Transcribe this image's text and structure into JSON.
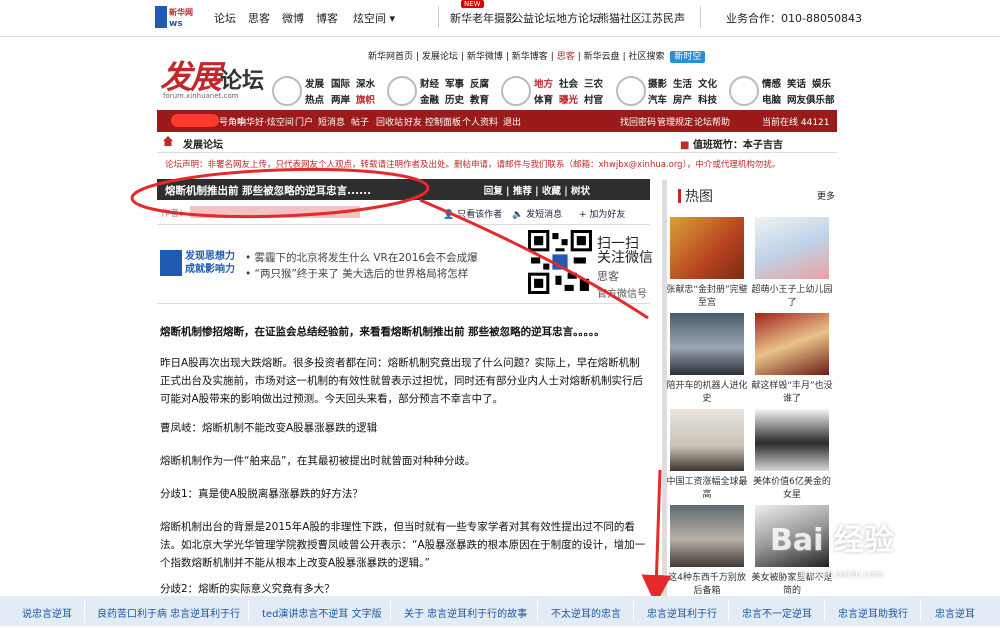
{
  "topnav": {
    "links": [
      "论坛",
      "思客",
      "微博",
      "博客",
      "炫空间"
    ],
    "links2": [
      "新华老年摄影",
      "公益论坛",
      "地方论坛",
      "熊猫社区",
      "江苏民声"
    ],
    "new_badge": "NEW",
    "contact": "业务合作：010-88050843",
    "logo_text": "新华网"
  },
  "site_links": [
    "新华网首页",
    "发展论坛",
    "新华微博",
    "新华博客",
    "思客",
    "新华云盘",
    "社区搜索"
  ],
  "site_links_badge": "新时空",
  "forum": {
    "title_red": "发展",
    "title_black": "论坛",
    "subtitle": "forum.xinhuanet.com"
  },
  "channels": {
    "g1": [
      "发展",
      "国际",
      "深水",
      "热点",
      "两岸",
      "旗帜"
    ],
    "g2": [
      "财经",
      "军事",
      "反腐",
      "金融",
      "历史",
      "教育"
    ],
    "g3": [
      "地方",
      "社会",
      "三农",
      "体育",
      "曝光",
      "村官"
    ],
    "g4": [
      "摄影",
      "生活",
      "文化",
      "汽车",
      "房产",
      "科技"
    ],
    "g5": [
      "情感",
      "笑话",
      "娱乐",
      "电脑",
      "网友俱乐部"
    ]
  },
  "redbar": {
    "items": [
      "号角响",
      "中华好·炫空间",
      "门户",
      "短消息",
      "帖子",
      "回收站",
      "好友",
      "控制面板",
      "个人资料",
      "退出"
    ],
    "right": [
      "找回密码",
      "管理规定",
      "论坛帮助"
    ],
    "online": "当前在线 44121"
  },
  "breadcrumb": "发展论坛",
  "breadcrumb_right": "值班斑竹：本子吉吉",
  "notice": "论坛声明：非署名网友上传，只代表网友个人观点，转载请注明作者及出处。删帖申请，请邮件与我们联系（邮箱：xhwjbx@xinhua.org），中介或代理机构勿扰。",
  "post": {
    "title": "熔断机制推出前 那些被忽略的逆耳忠言......",
    "actions": "回复 | 推荐 | 收藏 | 树状",
    "meta": "作者：",
    "only_author": "只看该作者",
    "send_msg": "发短消息",
    "add_friend": "加为好友"
  },
  "promo": {
    "logo_line1": "发现思想力",
    "logo_line2": "成就影响力",
    "line1": "• 雾霾下的北京将发生什么 VR在2016会不会成爆",
    "line2": "• “两只猴”终于来了 美大选后的世界格局将怎样",
    "qr_line1": "扫一扫",
    "qr_line2": "关注微信",
    "qr_line3": "思客",
    "qr_line4": "官方微信号"
  },
  "article": {
    "intro": "熔断机制惨招熔断，在证监会总结经验前，来看看熔断机制推出前 那些被忽略的逆耳忠言。。。。。",
    "p1": "昨日A股再次出现大跌熔断。很多投资者都在问：熔断机制究竟出现了什么问题？实际上，早在熔断机制正式出台及实施前，市场对这一机制的有效性就曾表示过担忧，同时还有部分业内人士对熔断机制实行后可能对A股带来的影响做出过预测。今天回头来看，部分预言不幸言中了。",
    "p2": "曹凤岐：熔断机制不能改变A股暴涨暴跌的逻辑",
    "p3": "熔断机制作为一件“舶来品”，在其最初被提出时就曾面对种种分歧。",
    "p4": "分歧1：真是使A股脱离暴涨暴跌的好方法？",
    "p5": "熔断机制出台的背景是2015年A股的非理性下跌，但当时就有一些专家学者对其有效性提出过不同的看法。如北京大学光华管理学院教授曹凤岐曾公开表示：“A股暴涨暴跌的根本原因在于制度的设计，增加一个指数熔断机制并不能从根本上改变A股暴涨暴跌的逻辑。”",
    "p6": "分歧2：熔断的实际意义究竟有多大？"
  },
  "hot": {
    "title": "热图",
    "more": "更多",
    "items": [
      {
        "caption": "张献忠“金封册”完璧至宫"
      },
      {
        "caption": "超萌小王子上幼儿园了"
      },
      {
        "caption": "陪开车的机器人进化史"
      },
      {
        "caption": "献这样毁“丰月”也没谁了"
      },
      {
        "caption": "中国工资涨幅全球最高"
      },
      {
        "caption": "美体价值6亿美金的女星"
      },
      {
        "caption": "这4种东西千万别放后备箱"
      },
      {
        "caption": "美女被胁家里都不是简的"
      }
    ]
  },
  "tags": [
    "说忠言逆耳",
    "良药苦口利于病 忠言逆耳利于行",
    "ted演讲忠言不逆耳 文字版",
    "关于 忠言逆耳利于行的故事",
    "不太逆耳的忠言",
    "忠言逆耳利于行",
    "忠言不一定逆耳",
    "忠言逆耳助我行",
    "忠言逆耳"
  ],
  "watermark": {
    "brand": "Bai 经验",
    "url": "jingyan.baidu.com"
  },
  "colors": {
    "brand_red": "#9b1b1b",
    "title_bar": "#2e2e2e",
    "link_blue": "#1a55a4",
    "annotation": "#e52a2a"
  }
}
